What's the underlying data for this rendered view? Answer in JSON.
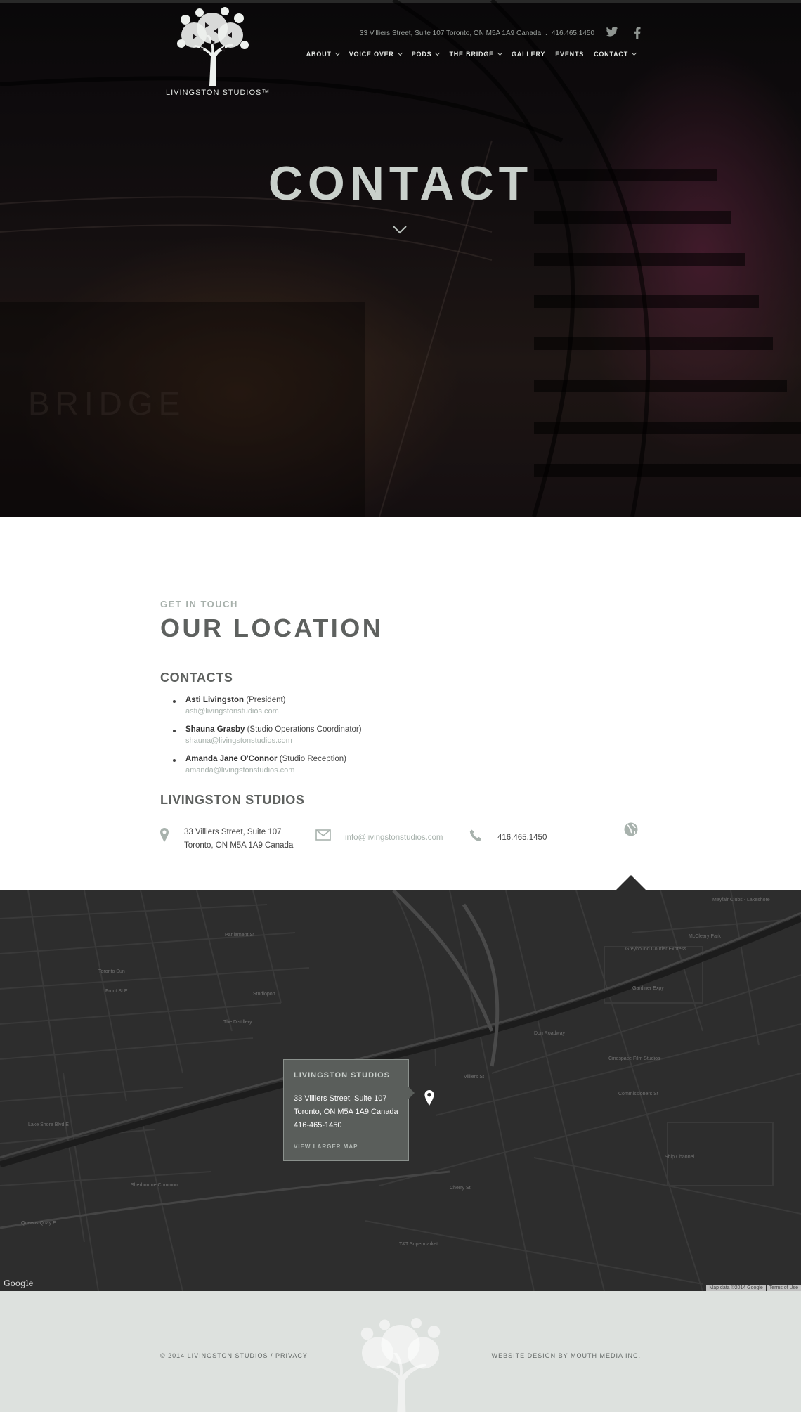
{
  "header": {
    "logo_text": "LIVINGSTON STUDIOS™",
    "address": "33 Villiers Street, Suite 107 Toronto, ON M5A 1A9 Canada",
    "separator": ".",
    "phone": "416.465.1450",
    "social": [
      {
        "name": "twitter-icon"
      },
      {
        "name": "facebook-icon"
      }
    ],
    "nav": [
      {
        "label": "ABOUT",
        "dropdown": true
      },
      {
        "label": "VOICE OVER",
        "dropdown": true
      },
      {
        "label": "PODS",
        "dropdown": true
      },
      {
        "label": "THE BRIDGE",
        "dropdown": true
      },
      {
        "label": "GALLERY",
        "dropdown": false
      },
      {
        "label": "EVENTS",
        "dropdown": false
      },
      {
        "label": "CONTACT",
        "dropdown": true
      }
    ]
  },
  "hero": {
    "title": "CONTACT",
    "hero_watermark": "BRIDGE"
  },
  "main": {
    "eyebrow": "GET IN TOUCH",
    "heading": "OUR LOCATION",
    "contacts_heading": "CONTACTS",
    "contacts": [
      {
        "name": "Asti Livingston",
        "role": "(President)",
        "email": "asti@livingstonstudios.com"
      },
      {
        "name": "Shauna Grasby",
        "role": "(Studio Operations Coordinator)",
        "email": "shauna@livingstonstudios.com"
      },
      {
        "name": "Amanda Jane O'Connor",
        "role": "(Studio Reception)",
        "email": "amanda@livingstonstudios.com"
      }
    ],
    "studio_heading": "LIVINGSTON STUDIOS",
    "address_line1": "33 Villiers Street, Suite 107",
    "address_line2": "Toronto, ON M5A 1A9 Canada",
    "email": "info@livingstonstudios.com",
    "phone": "416.465.1450"
  },
  "map": {
    "infobox": {
      "title": "LIVINGSTON STUDIOS",
      "line1": "33 Villiers Street, Suite 107",
      "line2": "Toronto, ON M5A 1A9 Canada",
      "line3": "416-465-1450",
      "link": "VIEW LARGER MAP"
    },
    "provider": "Google",
    "attribution": "Map data ©2014 Google",
    "terms": "Terms of Use",
    "labels": [
      {
        "text": "Toronto Sun"
      },
      {
        "text": "Front St E"
      },
      {
        "text": "Studioport"
      },
      {
        "text": "The Distillery"
      },
      {
        "text": "Gardiner Expy"
      },
      {
        "text": "Lake Shore Blvd E"
      },
      {
        "text": "Commissioners St"
      },
      {
        "text": "Cherry St"
      },
      {
        "text": "Villiers St"
      },
      {
        "text": "Don Roadway"
      },
      {
        "text": "Greyhound Courier Express"
      },
      {
        "text": "Mayfair Clubs - Lakeshore"
      },
      {
        "text": "McCleary Park"
      },
      {
        "text": "Cinespace Film Studios"
      },
      {
        "text": "Queens Quay E"
      },
      {
        "text": "Sherbourne Common"
      },
      {
        "text": "T&T Supermarket"
      },
      {
        "text": "Ship Channel"
      },
      {
        "text": "Parliament St"
      }
    ]
  },
  "footer": {
    "copyright": "© 2014 LIVINGSTON STUDIOS / PRIVACY",
    "credit": "WEBSITE DESIGN BY MOUTH MEDIA INC."
  },
  "colors": {
    "accent_light": "#a8b2ad",
    "heading": "#5e615f",
    "map_bg": "#2d2d2d",
    "footer_bg": "#dde1de"
  }
}
